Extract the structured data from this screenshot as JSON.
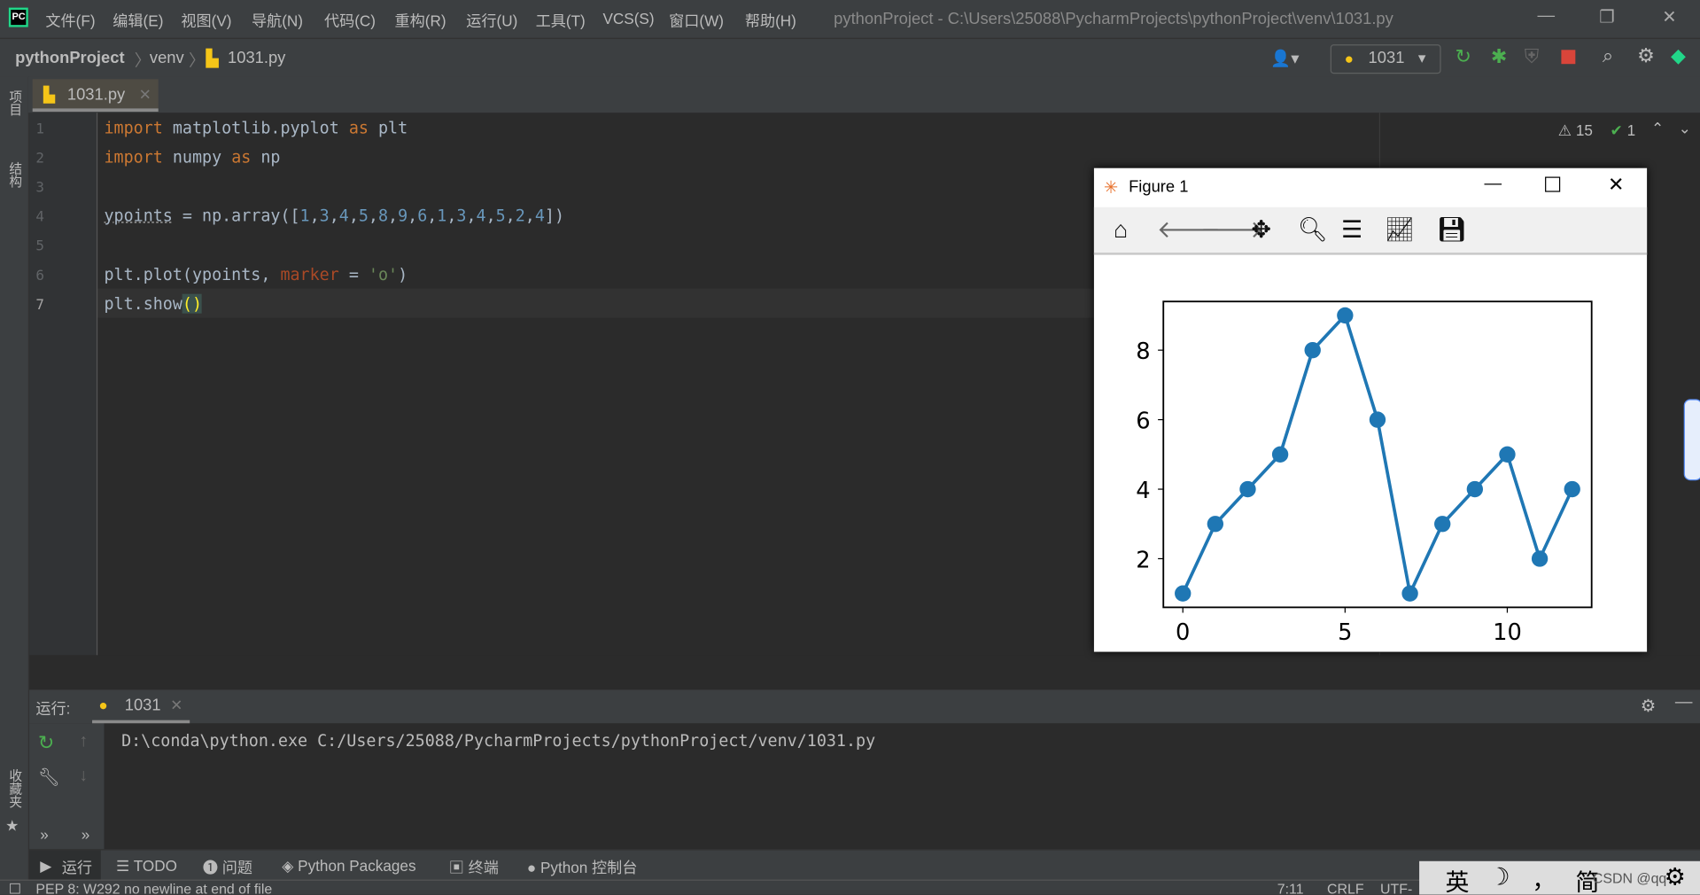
{
  "window": {
    "title": "pythonProject - C:\\Users\\25088\\PycharmProjects\\pythonProject\\venv\\1031.py",
    "logo": "PC"
  },
  "menu": [
    "文件(F)",
    "编辑(E)",
    "视图(V)",
    "导航(N)",
    "代码(C)",
    "重构(R)",
    "运行(U)",
    "工具(T)",
    "VCS(S)",
    "窗口(W)",
    "帮助(H)"
  ],
  "breadcrumb": [
    "pythonProject",
    "venv",
    "1031.py"
  ],
  "toolbar": {
    "run_config": "1031"
  },
  "editor": {
    "tab": "1031.py",
    "warnings": "15",
    "ok": "1",
    "line_numbers": [
      "1",
      "2",
      "3",
      "4",
      "5",
      "6",
      "7"
    ]
  },
  "left_tools": [
    "项目",
    "结构",
    "收藏夹"
  ],
  "figure": {
    "title": "Figure 1",
    "toolbar_icons": [
      "home-icon",
      "back-icon",
      "forward-icon",
      "pan-icon",
      "zoom-icon",
      "configure-subplots-icon",
      "edit-axis-icon",
      "save-icon"
    ]
  },
  "chart_data": {
    "type": "line",
    "marker": "o",
    "color": "#1f77b4",
    "x": [
      0,
      1,
      2,
      3,
      4,
      5,
      6,
      7,
      8,
      9,
      10,
      11,
      12
    ],
    "values": [
      1,
      3,
      4,
      5,
      8,
      9,
      6,
      1,
      3,
      4,
      5,
      2,
      4
    ],
    "xticks": [
      "0",
      "5",
      "10"
    ],
    "yticks": [
      "2",
      "4",
      "6",
      "8"
    ],
    "xlim": [
      -0.6,
      12.6
    ],
    "ylim": [
      0.6,
      9.4
    ],
    "grid": false
  },
  "run": {
    "label": "运行:",
    "tab": "1031",
    "output": "D:\\conda\\python.exe C:/Users/25088/PycharmProjects/pythonProject/venv/1031.py"
  },
  "bottom_tabs": [
    "运行",
    "TODO",
    "问题",
    "Python Packages",
    "终端",
    "Python 控制台"
  ],
  "status": {
    "message": "PEP 8: W292 no newline at end of file",
    "position": "7:11",
    "line_sep": "CRLF",
    "encoding": "UTF-"
  },
  "ime": {
    "lang": "英",
    "punct": "，",
    "mode": "简",
    "watermark": "CSDN @qq"
  }
}
